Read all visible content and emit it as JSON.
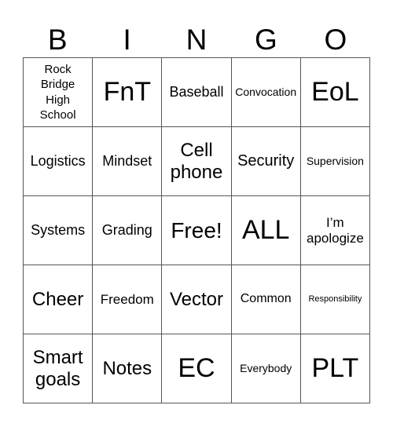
{
  "header": {
    "letters": [
      "B",
      "I",
      "N",
      "G",
      "O"
    ]
  },
  "rows": [
    [
      {
        "text": "Rock Bridge High School",
        "lines": [
          "Rock",
          "Bridge",
          "High",
          "School"
        ]
      },
      {
        "text": "FnT"
      },
      {
        "text": "Baseball"
      },
      {
        "text": "Convocation"
      },
      {
        "text": "EoL"
      }
    ],
    [
      {
        "text": "Logistics"
      },
      {
        "text": "Mindset"
      },
      {
        "text": "Cell phone",
        "lines": [
          "Cell",
          "phone"
        ]
      },
      {
        "text": "Security"
      },
      {
        "text": "Supervision"
      }
    ],
    [
      {
        "text": "Systems"
      },
      {
        "text": "Grading"
      },
      {
        "text": "Free!"
      },
      {
        "text": "ALL"
      },
      {
        "text": "I’m apologize",
        "lines": [
          "I’m",
          "apologize"
        ]
      }
    ],
    [
      {
        "text": "Cheer"
      },
      {
        "text": "Freedom"
      },
      {
        "text": "Vector"
      },
      {
        "text": "Common"
      },
      {
        "text": "Responsibility"
      }
    ],
    [
      {
        "text": "Smart goals",
        "lines": [
          "Smart",
          "goals"
        ]
      },
      {
        "text": "Notes"
      },
      {
        "text": "EC"
      },
      {
        "text": "Everybody"
      },
      {
        "text": "PLT"
      }
    ]
  ]
}
